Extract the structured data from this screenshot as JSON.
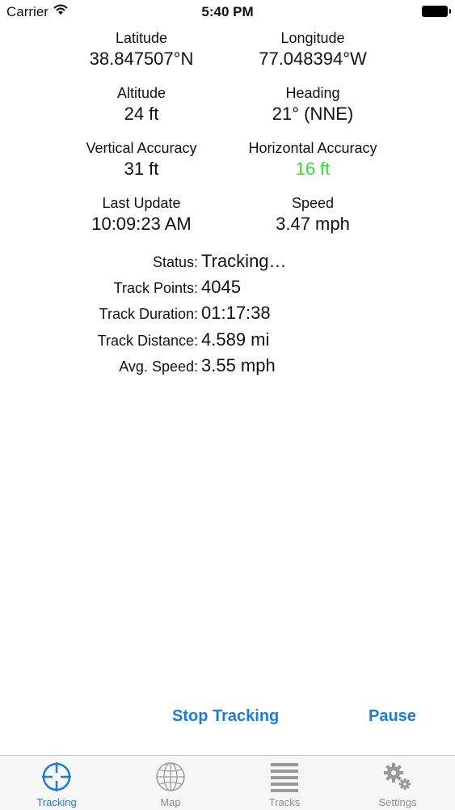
{
  "status_bar": {
    "carrier": "Carrier",
    "time": "5:40 PM"
  },
  "metrics": [
    {
      "label": "Latitude",
      "value": "38.847507°N"
    },
    {
      "label": "Longitude",
      "value": "77.048394°W"
    },
    {
      "label": "Altitude",
      "value": "24 ft"
    },
    {
      "label": "Heading",
      "value": "21° (NNE)"
    },
    {
      "label": "Vertical Accuracy",
      "value": "31 ft"
    },
    {
      "label": "Horizontal Accuracy",
      "value": "16 ft"
    },
    {
      "label": "Last Update",
      "value": "10:09:23 AM"
    },
    {
      "label": "Speed",
      "value": "3.47 mph"
    }
  ],
  "highlight_color": "#2ee52e",
  "accent_color": "#1a7ed6",
  "info": [
    {
      "label": "Status:",
      "value": "Tracking…"
    },
    {
      "label": "Track Points:",
      "value": "4045"
    },
    {
      "label": "Track Duration:",
      "value": "01:17:38"
    },
    {
      "label": "Track Distance:",
      "value": "4.589 mi"
    },
    {
      "label": "Avg. Speed:",
      "value": "3.55 mph"
    }
  ],
  "actions": {
    "stop": "Stop Tracking",
    "pause": "Pause"
  },
  "tabs": [
    {
      "label": "Tracking",
      "icon": "crosshair-icon",
      "active": true
    },
    {
      "label": "Map",
      "icon": "globe-icon",
      "active": false
    },
    {
      "label": "Tracks",
      "icon": "list-icon",
      "active": false
    },
    {
      "label": "Settings",
      "icon": "gears-icon",
      "active": false
    }
  ]
}
